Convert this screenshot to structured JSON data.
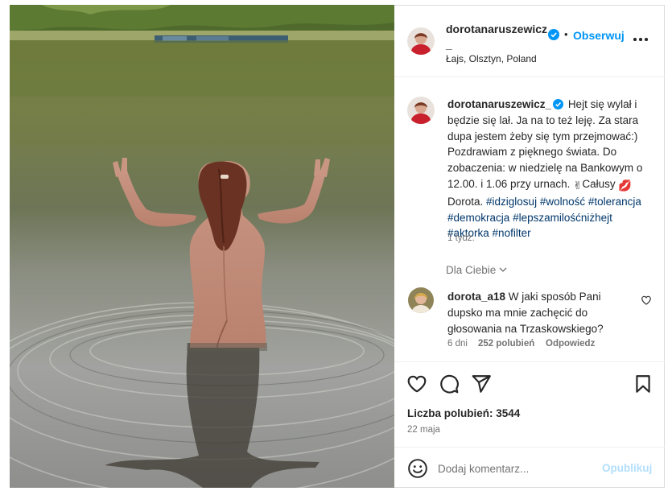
{
  "post": {
    "username": "dorotanaruszewicz",
    "username_suffix": "_",
    "follow_label": "Obserwuj",
    "separator": "•",
    "location": "Łajs, Olsztyn, Poland"
  },
  "caption": {
    "username": "dorotanaruszewicz_",
    "text_1": "Hejt się wylał i będzie się lał. Ja na to też leję. Za stara dupa jestem żeby się tym przejmować:) Pozdrawiam z pięknego świata. Do zobaczenia: w niedzielę na Bankowym o 12.00. i 1.06 przy urnach. ",
    "emoji_hand": "✌",
    "text_2": "Całusy ",
    "emoji_lips": "💋",
    "text_3": " Dorota. ",
    "hashtags": [
      "#idziglosuj",
      "#wolność",
      "#tolerancja",
      "#demokracja",
      "#lepszamilośćniżhejt",
      "#aktorka",
      "#nofilter"
    ],
    "time": "1 tydz."
  },
  "for_you": {
    "label": "Dla Ciebie"
  },
  "comment": {
    "username": "dorota_a18",
    "text": "W jaki sposób Pani dupsko ma mnie zachęcić do głosowania na Trzaskowskiego?",
    "age": "6 dni",
    "likes": "252 polubień",
    "reply": "Odpowiedz"
  },
  "actions": {
    "icons": [
      "heart-icon",
      "comment-icon",
      "share-icon",
      "bookmark-icon"
    ],
    "likes_text": "Liczba polubień: 3544",
    "date": "22 maja"
  },
  "add_comment": {
    "placeholder": "Dodaj komentarz...",
    "publish_label": "Opublikuj"
  },
  "colors": {
    "link_blue": "#0095f6",
    "hashtag": "#00376b",
    "muted": "#737373",
    "publish_disabled": "#b2dffc",
    "border": "#dbdbdb"
  }
}
